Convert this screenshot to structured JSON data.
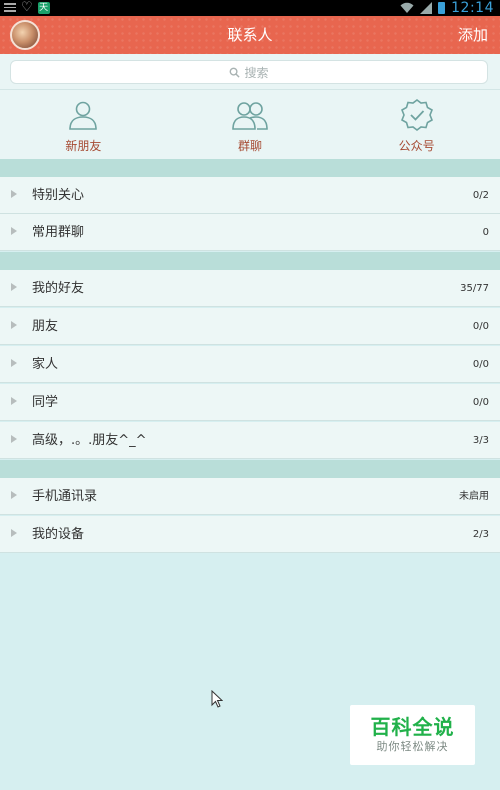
{
  "status_bar": {
    "time": "12:14",
    "app_badge": "天"
  },
  "header": {
    "title": "联系人",
    "add_label": "添加"
  },
  "search": {
    "placeholder": "搜索"
  },
  "quick": [
    {
      "label": "新朋友",
      "icon": "person-icon"
    },
    {
      "label": "群聊",
      "icon": "people-group-icon"
    },
    {
      "label": "公众号",
      "icon": "verified-badge-icon"
    }
  ],
  "groups": [
    {
      "name": "特别关心",
      "count": "0/2"
    },
    {
      "name": "常用群聊",
      "count": "0"
    },
    {
      "name": "我的好友",
      "count": "35/77"
    },
    {
      "name": "朋友",
      "count": "0/0"
    },
    {
      "name": "家人",
      "count": "0/0"
    },
    {
      "name": "同学",
      "count": "0/0"
    },
    {
      "name": "高级，.。.朋友^_^",
      "count": "3/3"
    },
    {
      "name": "手机通讯录",
      "count": "未启用"
    },
    {
      "name": "我的设备",
      "count": "2/3"
    }
  ],
  "watermark": {
    "title": "百科全说",
    "subtitle": "助你轻松解决"
  },
  "colors": {
    "header": "#e8664f",
    "accent_label": "#a64a32",
    "section_gap": "#b9ded9",
    "background": "#d6eff0"
  }
}
